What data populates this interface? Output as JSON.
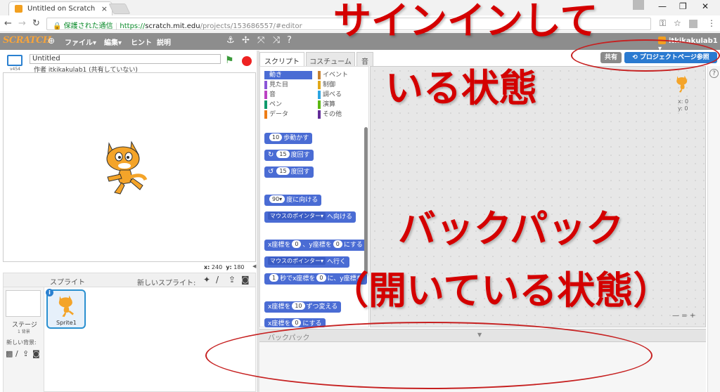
{
  "browser": {
    "tab_title": "Untitled on Scratch",
    "secure_label": "保護された通信",
    "url_scheme": "https://",
    "url_host": "scratch.mit.edu",
    "url_path": "/projects/153686557/#editor"
  },
  "menubar": {
    "logo": "SCRATCH",
    "file": "ファイル▾",
    "edit": "編集▾",
    "hint": "ヒント",
    "about": "説明",
    "username": "itkikakulab1 ▾"
  },
  "project": {
    "name": "Untitled",
    "author": "作者 itkikakulab1 (共有していない)",
    "version": "v454",
    "coords_x_label": "x:",
    "coords_x": "240",
    "coords_y_label": "y:",
    "coords_y": "180"
  },
  "tabs": {
    "scripts": "スクリプト",
    "costumes": "コスチューム",
    "sounds": "音"
  },
  "categories": [
    {
      "label": "動き",
      "color": "#4a6cd4"
    },
    {
      "label": "イベント",
      "color": "#c88330"
    },
    {
      "label": "見た目",
      "color": "#8a55d7"
    },
    {
      "label": "制御",
      "color": "#e1a91a"
    },
    {
      "label": "音",
      "color": "#bb42c3"
    },
    {
      "label": "調べる",
      "color": "#2ca5e2"
    },
    {
      "label": "ペン",
      "color": "#0e9a6c"
    },
    {
      "label": "演算",
      "color": "#5cb712"
    },
    {
      "label": "データ",
      "color": "#ee7d16"
    },
    {
      "label": "その他",
      "color": "#632d99"
    }
  ],
  "blocks": {
    "move_num": "10",
    "move_text": "歩動かす",
    "turn_r_num": "15",
    "turn_r_text": "度回す",
    "turn_l_num": "15",
    "turn_l_text": "度回す",
    "point_num": "90▾",
    "point_text": "度に向ける",
    "toward_drop": "マウスのポインター▾",
    "toward_text": "へ向ける",
    "gotoxy_a": "x座標を",
    "gotoxy_x": "0",
    "gotoxy_b": "、y座標を",
    "gotoxy_y": "0",
    "gotoxy_c": "にする",
    "goto_drop": "マウスのポインター▾",
    "goto_text": "へ行く",
    "glide_sec": "1",
    "glide_a": "秒でx座標を",
    "glide_x": "0",
    "glide_b": "に、y座標を",
    "changex_a": "x座標を",
    "changex_n": "10",
    "changex_b": "ずつ変える",
    "setx_a": "x座標を",
    "setx_n": "0",
    "setx_b": "にする"
  },
  "sprites": {
    "title": "スプライト",
    "new_sprite": "新しいスプライト:",
    "stage_label": "ステージ",
    "stage_sub": "1 背景",
    "new_backdrop": "新しい背景:",
    "sprite1": "Sprite1",
    "info": "i"
  },
  "scripts_area": {
    "share_button": "共有",
    "see_project_button": "プロジェクトページ参照",
    "sprite_x": "x: 0",
    "sprite_y": "y: 0",
    "zoom": "— = +",
    "help": "?"
  },
  "backpack": {
    "title": "バックパック",
    "arrow": "▼"
  },
  "annotations": {
    "signed_in_line1": "サインインして",
    "signed_in_line2": "いる状態",
    "backpack_line1": "バックパック",
    "backpack_line2": "（開いている状態）"
  },
  "colors": {
    "annotation": "#d40000",
    "motion": "#4a6cd4",
    "accent": "#2a7ad0"
  }
}
